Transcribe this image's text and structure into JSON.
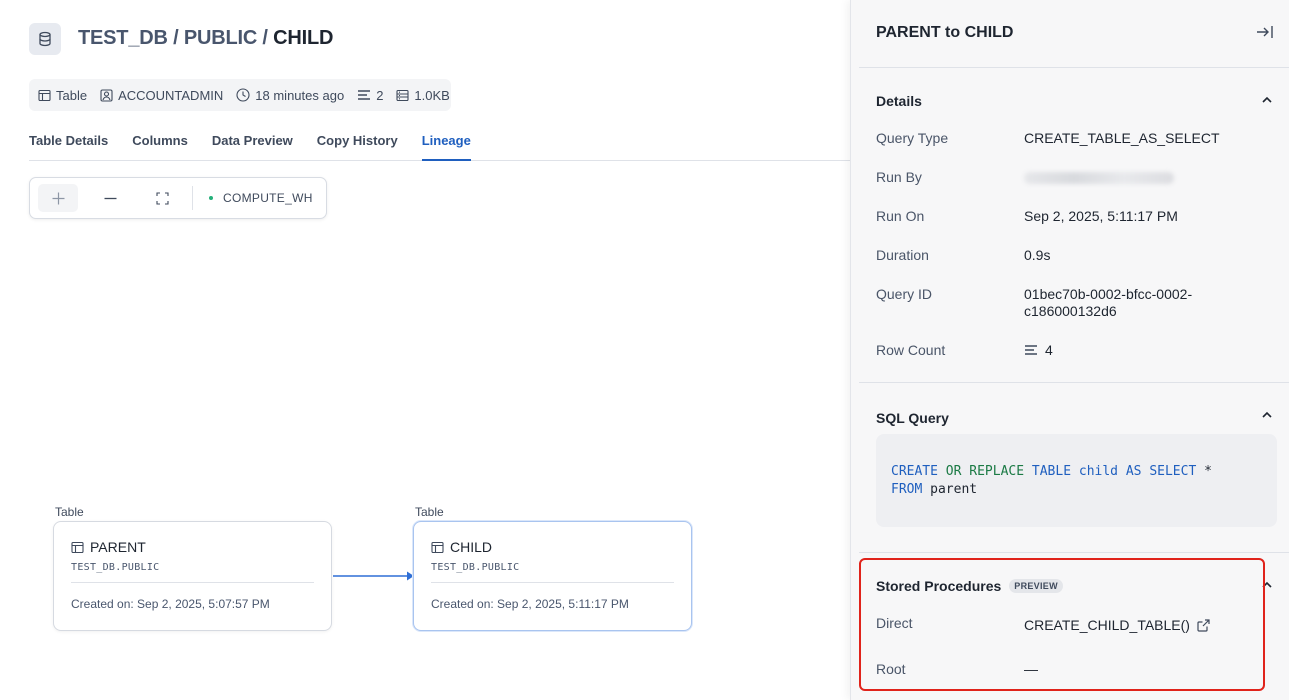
{
  "header": {
    "breadcrumb": [
      "TEST_DB",
      "PUBLIC",
      "CHILD"
    ],
    "separator": " / ",
    "icon": "database-icon"
  },
  "meta": {
    "object_type": "Table",
    "owner": "ACCOUNTADMIN",
    "modified": "18 minutes ago",
    "rows": "2",
    "size": "1.0KB"
  },
  "tabs": [
    {
      "label": "Table Details",
      "active": false
    },
    {
      "label": "Columns",
      "active": false
    },
    {
      "label": "Data Preview",
      "active": false
    },
    {
      "label": "Copy History",
      "active": false
    },
    {
      "label": "Lineage",
      "active": true
    }
  ],
  "toolbar": {
    "warehouse": "COMPUTE_WH",
    "zoom_in_icon": "plus-icon",
    "zoom_out_icon": "minus-icon",
    "fit_icon": "fullscreen-icon"
  },
  "graph": {
    "nodes": [
      {
        "type_label": "Table",
        "name": "PARENT",
        "path": "TEST_DB.PUBLIC",
        "created": "Created on: Sep 2, 2025, 5:07:57 PM"
      },
      {
        "type_label": "Table",
        "name": "CHILD",
        "path": "TEST_DB.PUBLIC",
        "created": "Created on: Sep 2, 2025, 5:11:17 PM"
      }
    ],
    "edge_color": "#2f6fd6"
  },
  "panel": {
    "title": "PARENT to CHILD",
    "details": {
      "title": "Details",
      "query_type_label": "Query Type",
      "query_type": "CREATE_TABLE_AS_SELECT",
      "run_by_label": "Run By",
      "run_on_label": "Run On",
      "run_on": "Sep 2, 2025, 5:11:17 PM",
      "duration_label": "Duration",
      "duration": "0.9s",
      "query_id_label": "Query ID",
      "query_id_1": "01bec70b-0002-bfcc-0002-",
      "query_id_2": "c186000132d6",
      "row_count_label": "Row Count",
      "row_count": "4"
    },
    "sql": {
      "title": "SQL Query",
      "t1": "CREATE",
      "t2": "OR",
      "t3": "REPLACE",
      "t4": "TABLE",
      "t5": "child",
      "t6": "AS",
      "t7": "SELECT",
      "t8": "*",
      "t9": "FROM",
      "t10": "parent"
    },
    "stored_procedures": {
      "title": "Stored Procedures",
      "badge": "PREVIEW",
      "direct_label": "Direct",
      "direct_value": "CREATE_CHILD_TABLE()",
      "root_label": "Root",
      "root_value": "—"
    }
  },
  "colors": {
    "accent": "#1f5fbf",
    "highlight": "#e0231b",
    "warehouse_dot": "#25b07a"
  }
}
